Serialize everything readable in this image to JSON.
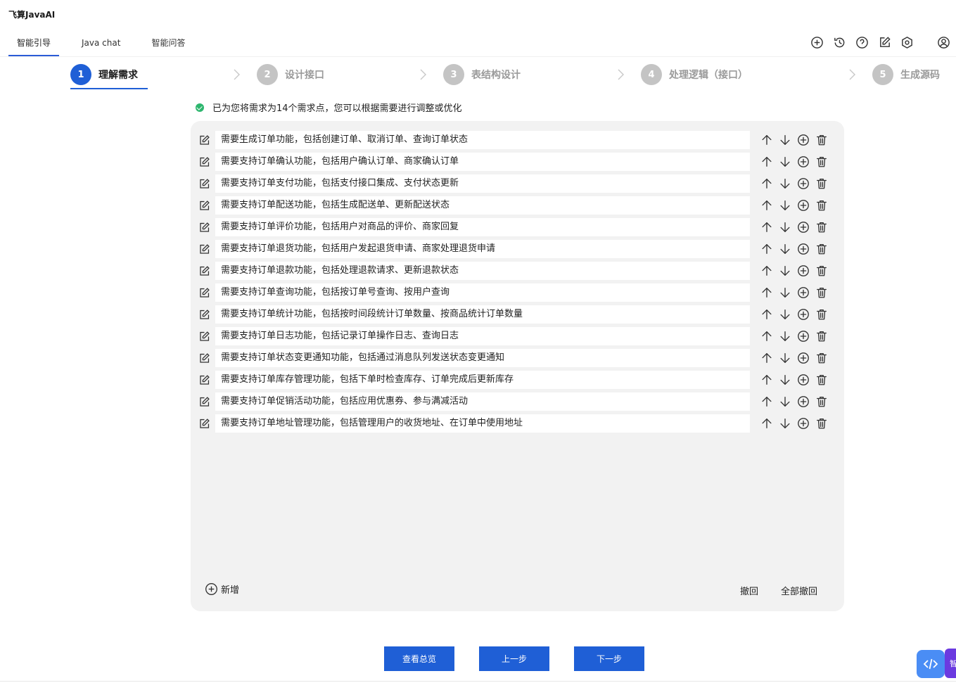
{
  "app": {
    "title": "飞算JavaAI"
  },
  "tabs": [
    {
      "label": "智能引导",
      "active": true
    },
    {
      "label": "Java chat",
      "active": false
    },
    {
      "label": "智能问答",
      "active": false
    }
  ],
  "toolbar_icons": [
    "plus-circle-icon",
    "history-icon",
    "help-icon",
    "edit-icon",
    "settings-icon",
    "user-icon"
  ],
  "steps": [
    {
      "num": "1",
      "label": "理解需求",
      "active": true
    },
    {
      "num": "2",
      "label": "设计接口",
      "active": false
    },
    {
      "num": "3",
      "label": "表结构设计",
      "active": false
    },
    {
      "num": "4",
      "label": "处理逻辑（接口）",
      "active": false
    },
    {
      "num": "5",
      "label": "生成源码",
      "active": false
    }
  ],
  "notice": "已为您将需求为14个需求点，您可以根据需要进行调整或优化",
  "requirements": [
    "需要生成订单功能，包括创建订单、取消订单、查询订单状态",
    "需要支持订单确认功能，包括用户确认订单、商家确认订单",
    "需要支持订单支付功能，包括支付接口集成、支付状态更新",
    "需要支持订单配送功能，包括生成配送单、更新配送状态",
    "需要支持订单评价功能，包括用户对商品的评价、商家回复",
    "需要支持订单退货功能，包括用户发起退货申请、商家处理退货申请",
    "需要支持订单退款功能，包括处理退款请求、更新退款状态",
    "需要支持订单查询功能，包括按订单号查询、按用户查询",
    "需要支持订单统计功能，包括按时间段统计订单数量、按商品统计订单数量",
    "需要支持订单日志功能，包括记录订单操作日志、查询日志",
    "需要支持订单状态变更通知功能，包括通过消息队列发送状态变更通知",
    "需要支持订单库存管理功能，包括下单时检查库存、订单完成后更新库存",
    "需要支持订单促销活动功能，包括应用优惠券、参与满减活动",
    "需要支持订单地址管理功能，包括管理用户的收货地址、在订单中使用地址"
  ],
  "panel_actions": {
    "add": "新增",
    "undo": "撤回",
    "undo_all": "全部撤回"
  },
  "buttons": {
    "overview": "查看总览",
    "prev": "上一步",
    "next": "下一步"
  },
  "float_side_label": "智",
  "colors": {
    "primary": "#1f5fd6",
    "panel_bg": "#f2f2f2",
    "success": "#2db66e",
    "float_code": "#4a8df5",
    "float_side": "#6b3ae0"
  }
}
